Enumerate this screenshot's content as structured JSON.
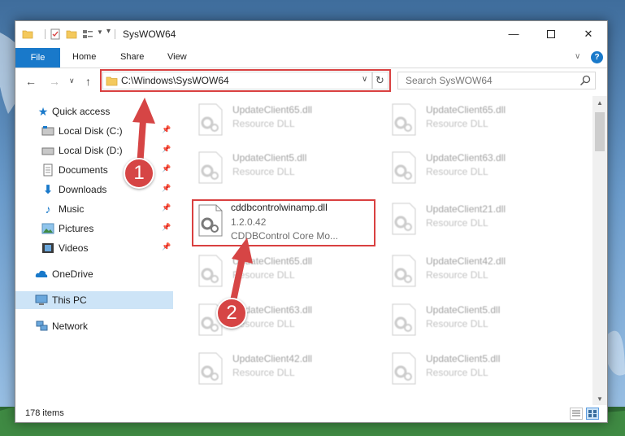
{
  "window": {
    "title": "SysWOW64"
  },
  "ribbon": {
    "tabs": [
      "File",
      "Home",
      "Share",
      "View"
    ],
    "help": "?"
  },
  "navbar": {
    "address": "C:\\Windows\\SysWOW64",
    "search_placeholder": "Search SysWOW64"
  },
  "sidebar": {
    "items": [
      {
        "label": "Quick access",
        "icon": "star-icon"
      },
      {
        "label": "Local Disk (C:)",
        "icon": "drive-icon",
        "pinned": true
      },
      {
        "label": "Local Disk (D:)",
        "icon": "drive-icon",
        "pinned": true
      },
      {
        "label": "Documents",
        "icon": "documents-icon",
        "pinned": true
      },
      {
        "label": "Downloads",
        "icon": "download-icon",
        "pinned": true
      },
      {
        "label": "Music",
        "icon": "music-icon",
        "pinned": true
      },
      {
        "label": "Pictures",
        "icon": "pictures-icon",
        "pinned": true
      },
      {
        "label": "Videos",
        "icon": "videos-icon",
        "pinned": true
      },
      {
        "label": "OneDrive",
        "icon": "cloud-icon"
      },
      {
        "label": "This PC",
        "icon": "computer-icon",
        "selected": true
      },
      {
        "label": "Network",
        "icon": "network-icon"
      }
    ]
  },
  "files": [
    {
      "name": "UpdateClient65.dll",
      "type": "Resource DLL"
    },
    {
      "name": "UpdateClient65.dll",
      "type": "Resource DLL"
    },
    {
      "name": "UpdateClient5.dll",
      "type": "Resource DLL"
    },
    {
      "name": "UpdateClient63.dll",
      "type": "Resource DLL"
    },
    {
      "name": "cddbcontrolwinamp.dll",
      "type": "1.2.0.42",
      "desc": "CDDBControl Core Mo...",
      "highlighted": true
    },
    {
      "name": "UpdateClient21.dll",
      "type": "Resource DLL"
    },
    {
      "name": "UpdateClient65.dll",
      "type": "Resource DLL"
    },
    {
      "name": "UpdateClient42.dll",
      "type": "Resource DLL"
    },
    {
      "name": "UpdateClient63.dll",
      "type": "Resource DLL"
    },
    {
      "name": "UpdateClient5.dll",
      "type": "Resource DLL"
    },
    {
      "name": "UpdateClient42.dll",
      "type": "Resource DLL"
    },
    {
      "name": "UpdateClient5.dll",
      "type": "Resource DLL"
    }
  ],
  "status": {
    "items_count": "178 items"
  },
  "annotations": [
    "1",
    "2"
  ],
  "colors": {
    "accent": "#1979ca",
    "highlight": "#d94040",
    "selected": "#cde4f7"
  }
}
